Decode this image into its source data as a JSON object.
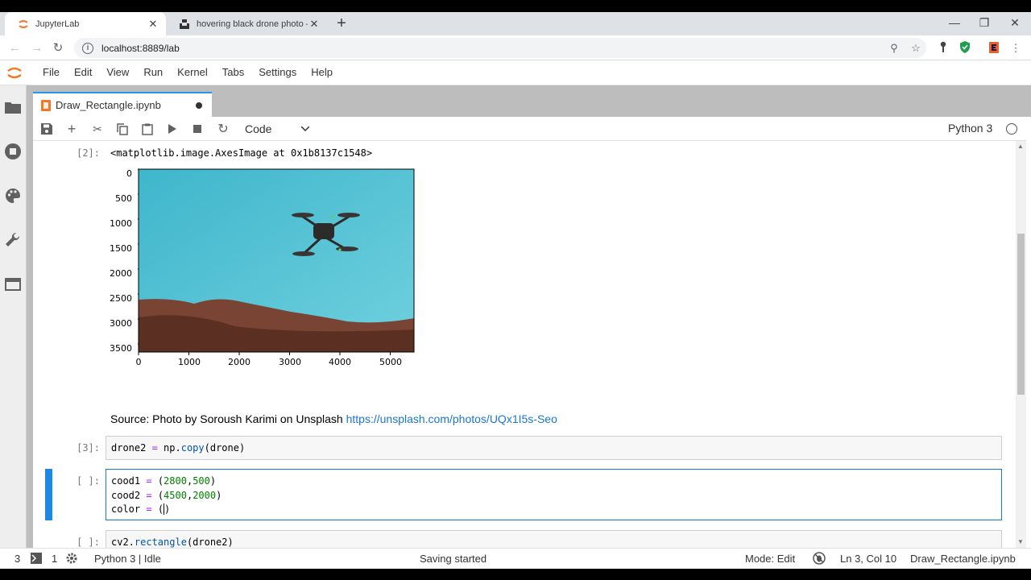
{
  "browser": {
    "tabs": [
      {
        "title": "JupyterLab",
        "active": true
      },
      {
        "title": "hovering black drone photo – Fre",
        "active": false
      }
    ],
    "url": "localhost:8889/lab"
  },
  "menu": [
    "File",
    "Edit",
    "View",
    "Run",
    "Kernel",
    "Tabs",
    "Settings",
    "Help"
  ],
  "notebook": {
    "tab_title": "Draw_Rectangle.ipynb",
    "cell_type": "Code",
    "kernel": "Python 3"
  },
  "cells": {
    "out2_prompt": "[2]:",
    "out2_text": "<matplotlib.image.AxesImage at 0x1b8137c1548>",
    "markdown_text": "Source: Photo by Soroush Karimi on Unsplash ",
    "markdown_link": "https://unsplash.com/photos/UQx1I5s-Seo",
    "cell3_prompt": "[3]:",
    "cell4_prompt": "[ ]:",
    "cell5_prompt": "[ ]:"
  },
  "chart_data": {
    "type": "image",
    "yticks": [
      "0",
      "500",
      "1000",
      "1500",
      "2000",
      "2500",
      "3000",
      "3500"
    ],
    "xticks": [
      "0",
      "1000",
      "2000",
      "3000",
      "4000",
      "5000"
    ],
    "xlim": [
      0,
      5472
    ],
    "ylim": [
      3648,
      0
    ]
  },
  "status": {
    "num1": "3",
    "num2": "1",
    "kernel_state": "Python 3 | Idle",
    "message": "Saving started",
    "mode": "Mode: Edit",
    "cursor": "Ln 3, Col 10",
    "file": "Draw_Rectangle.ipynb"
  },
  "colors": {
    "accent": "#1976d2",
    "jupyter_orange": "#f37726",
    "sky": "#4bbfd3"
  }
}
